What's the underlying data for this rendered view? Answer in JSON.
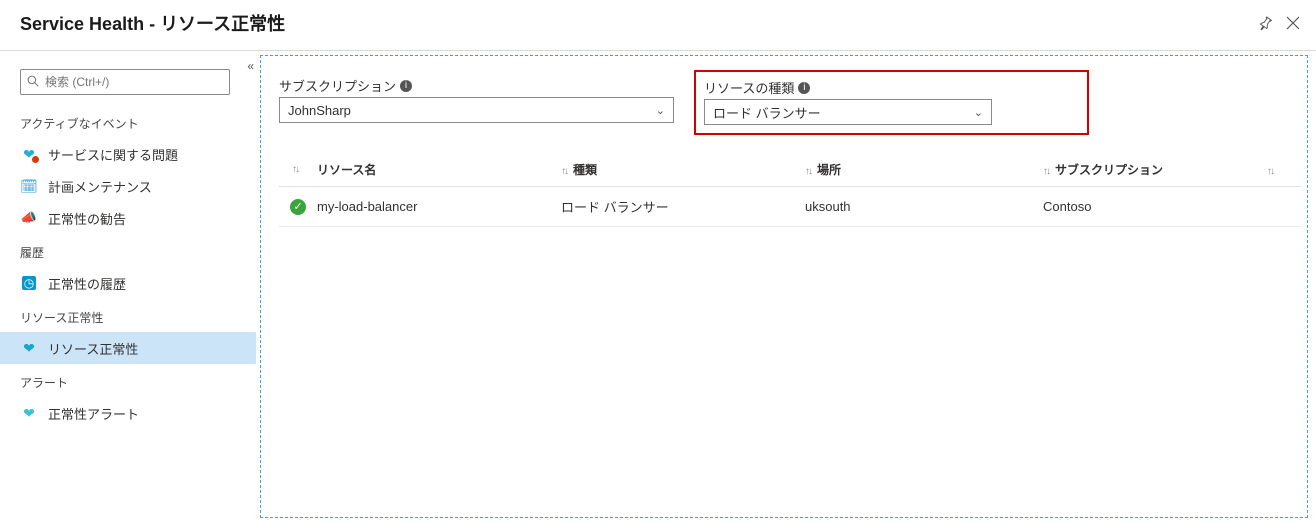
{
  "header": {
    "title": "Service Health - リソース正常性"
  },
  "sidebar": {
    "search_placeholder": "検索 (Ctrl+/)",
    "groups": [
      {
        "label": "アクティブなイベント",
        "items": [
          {
            "label": "サービスに関する問題"
          },
          {
            "label": "計画メンテナンス"
          },
          {
            "label": "正常性の勧告"
          }
        ]
      },
      {
        "label": "履歴",
        "items": [
          {
            "label": "正常性の履歴"
          }
        ]
      },
      {
        "label": "リソース正常性",
        "items": [
          {
            "label": "リソース正常性"
          }
        ]
      },
      {
        "label": "アラート",
        "items": [
          {
            "label": "正常性アラート"
          }
        ]
      }
    ]
  },
  "filters": {
    "subscription": {
      "label": "サブスクリプション",
      "value": "JohnSharp"
    },
    "resource_type": {
      "label": "リソースの種類",
      "value": "ロード バランサー"
    }
  },
  "table": {
    "columns": {
      "name": "リソース名",
      "type": "種類",
      "location": "場所",
      "subscription": "サブスクリプション"
    },
    "rows": [
      {
        "status": "ok",
        "name": "my-load-balancer",
        "type": "ロード バランサー",
        "location": "uksouth",
        "subscription": "Contoso"
      }
    ]
  }
}
